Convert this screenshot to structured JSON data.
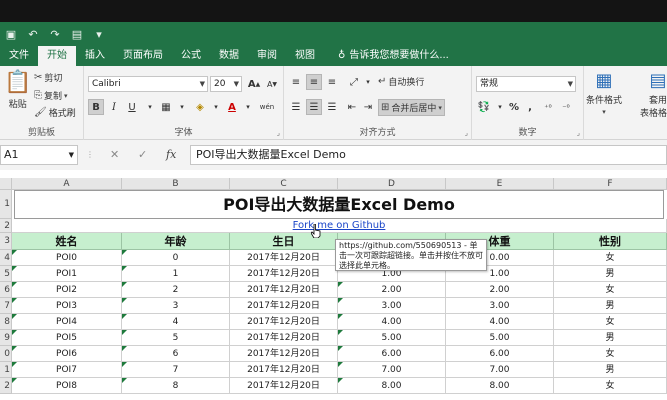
{
  "ribbon_tabs": [
    "文件",
    "开始",
    "插入",
    "页面布局",
    "公式",
    "数据",
    "审阅",
    "视图"
  ],
  "active_tab": "开始",
  "tell_me": "告诉我您想要做什么...",
  "clipboard": {
    "paste": "粘贴",
    "cut": "剪切",
    "copy": "复制",
    "format_painter": "格式刷",
    "label": "剪贴板"
  },
  "font": {
    "name": "Calibri",
    "size": "20",
    "bold": "B",
    "italic": "I",
    "underline": "U",
    "grow": "A",
    "shrink": "A",
    "label": "字体",
    "font_color": "A",
    "phonetic": "wén"
  },
  "alignment": {
    "wrap_text": "自动换行",
    "merge_center": "合并后居中",
    "label": "对齐方式"
  },
  "number": {
    "format": "常规",
    "percent": "%",
    "comma": ",",
    "label": "数字"
  },
  "styles": {
    "conditional": "条件格式",
    "table": "套用\n表格格式"
  },
  "formula_bar": {
    "name_box": "A1",
    "cancel": "✕",
    "enter": "✓",
    "fx": "fx",
    "formula": "POI导出大数据量Excel Demo"
  },
  "columns": [
    "A",
    "B",
    "C",
    "D",
    "E",
    "F"
  ],
  "row_numbers": [
    "1",
    "2",
    "3",
    "4",
    "5",
    "6",
    "7",
    "8",
    "9",
    "0",
    "1",
    "2"
  ],
  "sheet": {
    "title": "POI导出大数据量Excel Demo",
    "link_text": "Fork me on Github",
    "tooltip": "https://github.com/550690513 - 单击一次可跟踪超链接。单击并按住不放可选择此单元格。",
    "headers": [
      "姓名",
      "年龄",
      "生日",
      "",
      "体重",
      "性别"
    ],
    "rows": [
      [
        "POI0",
        "0",
        "2017年12月20日",
        "",
        "0.00",
        "女"
      ],
      [
        "POI1",
        "1",
        "2017年12月20日",
        "1.00",
        "1.00",
        "男"
      ],
      [
        "POI2",
        "2",
        "2017年12月20日",
        "2.00",
        "2.00",
        "女"
      ],
      [
        "POI3",
        "3",
        "2017年12月20日",
        "3.00",
        "3.00",
        "男"
      ],
      [
        "POI4",
        "4",
        "2017年12月20日",
        "4.00",
        "4.00",
        "女"
      ],
      [
        "POI5",
        "5",
        "2017年12月20日",
        "5.00",
        "5.00",
        "男"
      ],
      [
        "POI6",
        "6",
        "2017年12月20日",
        "6.00",
        "6.00",
        "女"
      ],
      [
        "POI7",
        "7",
        "2017年12月20日",
        "7.00",
        "7.00",
        "男"
      ],
      [
        "POI8",
        "8",
        "2017年12月20日",
        "8.00",
        "8.00",
        "女"
      ]
    ]
  },
  "colors": {
    "excel_green": "#217346",
    "header_fill": "#c6efce",
    "link": "#1a45c8"
  }
}
